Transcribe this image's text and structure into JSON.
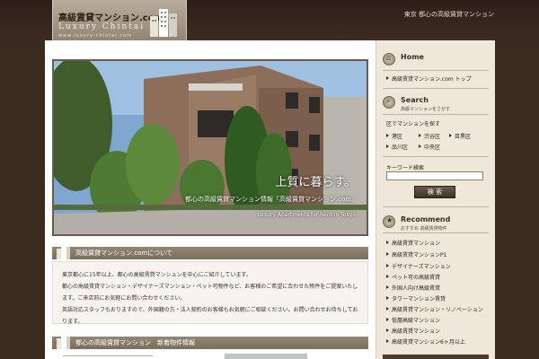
{
  "header": {
    "logo_jp": "高級賃貸マンション.com",
    "logo_en": "Luxury Chintai",
    "logo_url": "www.luxury-chintai.com",
    "tagline": "東京 都心の高級賃貸マンション"
  },
  "hero": {
    "catch": "上質に暮らす。",
    "sub": "都心の高級賃貸マンション情報「高級賃貸マンション.com」",
    "english": "Luxury Apartments for Rent in Tokyo"
  },
  "main": {
    "section1_title": "高級賃貸マンション.comについて",
    "section1_body": [
      "東京都心に15年以上、都心の高級賃貸マンションを中心にご紹介しています。",
      "都心の高級賃貸マンション・デザイナーズマンション・ペット可物件など、お客様のご希望に合わせた物件をご提案いたします。ご来店前にお気軽にお問い合わせください。",
      "英語対応スタッフもおりますので、外国籍の方・法人契約のお客様もお気軽にご相談ください。お問い合わせお待ちしております。"
    ],
    "section2_title": "都心の高級賃貸マンション　新着物件情報"
  },
  "sidebar": {
    "home": {
      "title": "Home",
      "links": [
        "高級賃貸マンション.com トップ"
      ]
    },
    "search": {
      "title": "Search",
      "subtitle": "高級マンションをさがす",
      "area_label": "区でマンションを探す",
      "areas": [
        "港区",
        "渋谷区",
        "目黒区",
        "品川区",
        "中央区"
      ],
      "keyword_label": "キーワード検索",
      "keyword_value": "",
      "button": "検 索"
    },
    "recommend": {
      "title": "Recommend",
      "subtitle": "おすすめ 高級賃貸物件",
      "links": [
        "高級賃貸マンション",
        "高級賃貸マンションP1",
        "デザイナーズマンション",
        "ペット可の高級賃貸",
        "外国人向け高級賃貸",
        "タワーマンション賃貸",
        "高級賃貸マンション・リノベーション",
        "低層高級マンション",
        "高級賃貸マンション",
        "高級賃貸マンション6ヶ月以上"
      ]
    }
  },
  "colors": {
    "header_bg": "#3a2a20",
    "sidebar_bg": "#efe7da",
    "section_head": "#8a7d6a",
    "text": "#2c241c"
  },
  "icons": {
    "logo_building": "building-icon",
    "section_icon": "building-icon",
    "home_icon": "home-icon",
    "search_icon": "search-icon",
    "recommend_icon": "star-icon"
  }
}
